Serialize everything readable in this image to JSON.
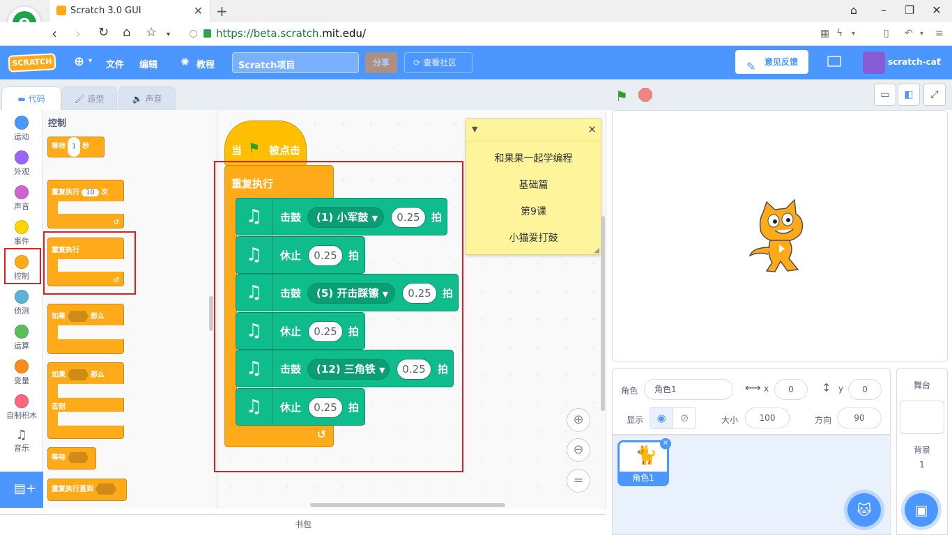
{
  "browser": {
    "tab_title": "Scratch 3.0 GUI",
    "url_prefix": "https://beta.scratch.",
    "url_domain": "mit.edu",
    "url_suffix": "/"
  },
  "menubar": {
    "logo": "SCRATCH",
    "file": "文件",
    "edit": "编辑",
    "tutorials": "教程",
    "project_title": "Scratch项目",
    "share": "分享",
    "community": "查看社区",
    "feedback": "意见反馈",
    "user": "scratch-cat"
  },
  "tabs": {
    "code": "代码",
    "costumes": "造型",
    "sounds": "声音"
  },
  "categories": [
    {
      "label": "运动",
      "color": "#4c97ff"
    },
    {
      "label": "外观",
      "color": "#9966ff"
    },
    {
      "label": "声音",
      "color": "#cf63cf"
    },
    {
      "label": "事件",
      "color": "#ffd500"
    },
    {
      "label": "控制",
      "color": "#ffab19"
    },
    {
      "label": "侦测",
      "color": "#5cb1d6"
    },
    {
      "label": "运算",
      "color": "#59c059"
    },
    {
      "label": "变量",
      "color": "#ff8c1a"
    },
    {
      "label": "自制积木",
      "color": "#ff6680"
    },
    {
      "label": "音乐",
      "color": "#0fbd8c"
    }
  ],
  "palette": {
    "title": "控制",
    "wait_label": "等待",
    "wait_value": "1",
    "wait_unit": "秒",
    "repeat_label": "重复执行",
    "repeat_value": "10",
    "repeat_unit": "次",
    "forever_label": "重复执行",
    "if_label": "如果",
    "then_label": "那么",
    "if2_label": "如果",
    "then2_label": "那么",
    "else_label": "否则",
    "wait_until_label": "等待",
    "repeat_until_label": "重复执行直到"
  },
  "script": {
    "hat_when": "当",
    "hat_clicked": "被点击",
    "forever": "重复执行",
    "blocks": [
      {
        "label": "击鼓",
        "drum": "(1) 小军鼓",
        "beats": "0.25",
        "unit": "拍"
      },
      {
        "label": "休止",
        "beats": "0.25",
        "unit": "拍"
      },
      {
        "label": "击鼓",
        "drum": "(5) 开击踩镲",
        "beats": "0.25",
        "unit": "拍"
      },
      {
        "label": "休止",
        "beats": "0.25",
        "unit": "拍"
      },
      {
        "label": "击鼓",
        "drum": "(12) 三角铁",
        "beats": "0.25",
        "unit": "拍"
      },
      {
        "label": "休止",
        "beats": "0.25",
        "unit": "拍"
      }
    ]
  },
  "note": {
    "lines": [
      "和果果一起学编程",
      "基础篇",
      "第9课",
      "小猫爱打鼓"
    ]
  },
  "sprite_info": {
    "sprite_label": "角色",
    "sprite_name": "角色1",
    "x_label": "x",
    "x_value": "0",
    "y_label": "y",
    "y_value": "0",
    "show_label": "显示",
    "size_label": "大小",
    "size_value": "100",
    "direction_label": "方向",
    "direction_value": "90"
  },
  "sprites": [
    {
      "name": "角色1"
    }
  ],
  "stage_panel": {
    "title": "舞台",
    "backdrop_label": "背景",
    "backdrop_count": "1"
  },
  "backpack": "书包"
}
